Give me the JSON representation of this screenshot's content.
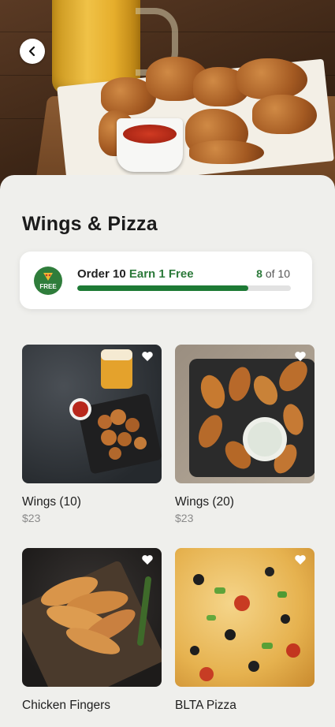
{
  "hero": {
    "image": "fried chicken wings with dipping sauce and beer"
  },
  "nav": {
    "back_icon": "chevron-left-icon"
  },
  "page": {
    "title": "Wings & Pizza"
  },
  "promo": {
    "badge_text": "FREE",
    "order_text": "Order 10",
    "earn_text": "Earn 1 Free",
    "current": "8",
    "of_text": "of 10",
    "progress_fraction": 0.8,
    "accent_color": "#2c7a3a"
  },
  "items": [
    {
      "name": "Wings (10)",
      "price": "$23",
      "favorite_icon": "heart-icon"
    },
    {
      "name": "Wings (20)",
      "price": "$23",
      "favorite_icon": "heart-icon"
    },
    {
      "name": "Chicken Fingers",
      "price": "",
      "favorite_icon": "heart-icon"
    },
    {
      "name": "BLTA Pizza",
      "price": "",
      "favorite_icon": "heart-icon"
    }
  ]
}
